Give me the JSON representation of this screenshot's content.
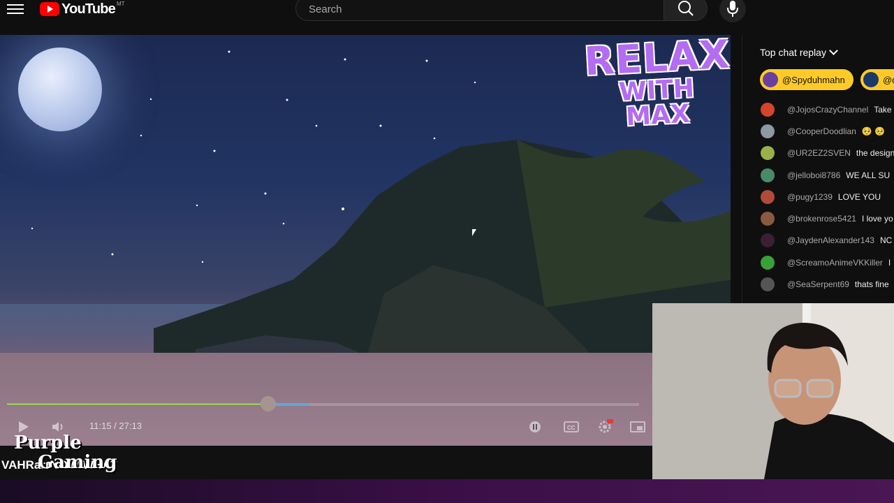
{
  "header": {
    "logo_text": "YouTube",
    "logo_superscript": "MT",
    "search_placeholder": "Search"
  },
  "video": {
    "overlay_logo": {
      "line1": "RELAX",
      "line2": "WITH MAX"
    },
    "time_current": "11:15",
    "time_total": "27:13",
    "time_display": "11:15 / 27:13",
    "progress_fraction": 0.413,
    "buffer_fraction": 0.065,
    "caption_text": "VAHRarrNOW WHAT"
  },
  "chat": {
    "title": "Top chat replay",
    "pinned": [
      {
        "name": "@Spyduhmahn",
        "color": "#ffca28"
      },
      {
        "name": "@d",
        "color": "#ffca28"
      }
    ],
    "messages": [
      {
        "user": "@JojosCrazyChannel",
        "text": "Take",
        "avatar_color": "#d4452b"
      },
      {
        "user": "@CooperDoodlian",
        "text": "🥺 🥺",
        "avatar_color": "#8b9aa0"
      },
      {
        "user": "@UR2EZ2SVEN",
        "text": "the design",
        "avatar_color": "#9bb04a"
      },
      {
        "user": "@jelloboi8786",
        "text": "WE ALL SU",
        "avatar_color": "#4a8a6a"
      },
      {
        "user": "@pugy1239",
        "text": "LOVE YOU",
        "avatar_color": "#b04a3a"
      },
      {
        "user": "@brokenrose5421",
        "text": "I love yo",
        "avatar_color": "#8a5a40"
      },
      {
        "user": "@JaydenAlexander143",
        "text": "NC",
        "avatar_color": "#3a2030"
      },
      {
        "user": "@ScreamoAnimeVKKiller",
        "text": "I",
        "avatar_color": "#3aa03a"
      },
      {
        "user": "@SeaSerpent69",
        "text": "thats fine",
        "avatar_color": "#555555"
      }
    ]
  },
  "channel_watermark": {
    "line1": "Purple",
    "line2": "Gaming"
  },
  "colors": {
    "accent_red": "#ff0000",
    "pinned_gold": "#ffca28",
    "relax_purple": "#b36cf2"
  }
}
